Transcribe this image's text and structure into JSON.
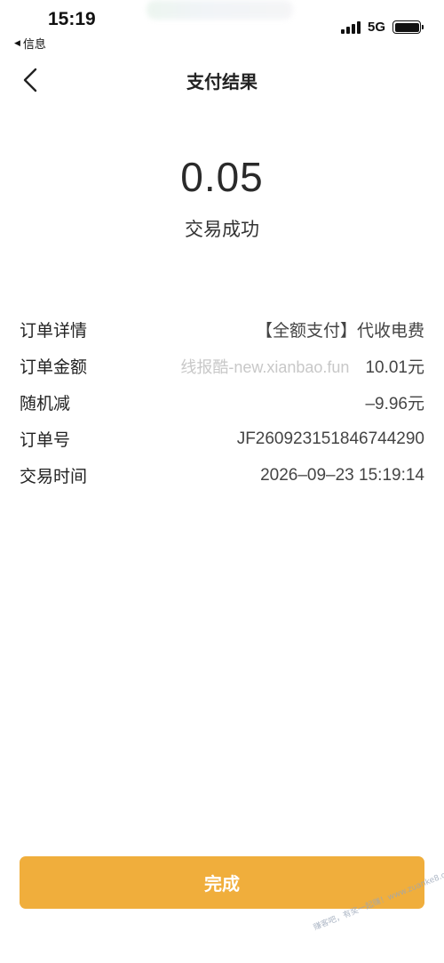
{
  "status_bar": {
    "time": "15:19",
    "back_app": "信息",
    "network": "5G"
  },
  "nav": {
    "title": "支付结果"
  },
  "result": {
    "amount": "0.05",
    "status": "交易成功"
  },
  "details": {
    "rows": [
      {
        "label": "订单详情",
        "value": "【全额支付】代收电费"
      },
      {
        "label": "订单金额",
        "value": "10.01元",
        "watermark": "线报酷-new.xianbao.fun"
      },
      {
        "label": "随机减",
        "value": "–9.96元"
      },
      {
        "label": "订单号",
        "value": "JF260923151846744290"
      },
      {
        "label": "交易时间",
        "value": "2026–09–23 15:19:14"
      }
    ]
  },
  "done_button": {
    "label": "完成"
  },
  "corner_watermark": "赚客吧，有奖一起赚！www.zuanke8.com",
  "colors": {
    "accent": "#f0ae3c",
    "background": "#ffffff",
    "text": "#222222"
  },
  "icons": {
    "back": "chevron-left-icon",
    "signal": "signal-bars-icon",
    "battery": "battery-icon"
  }
}
